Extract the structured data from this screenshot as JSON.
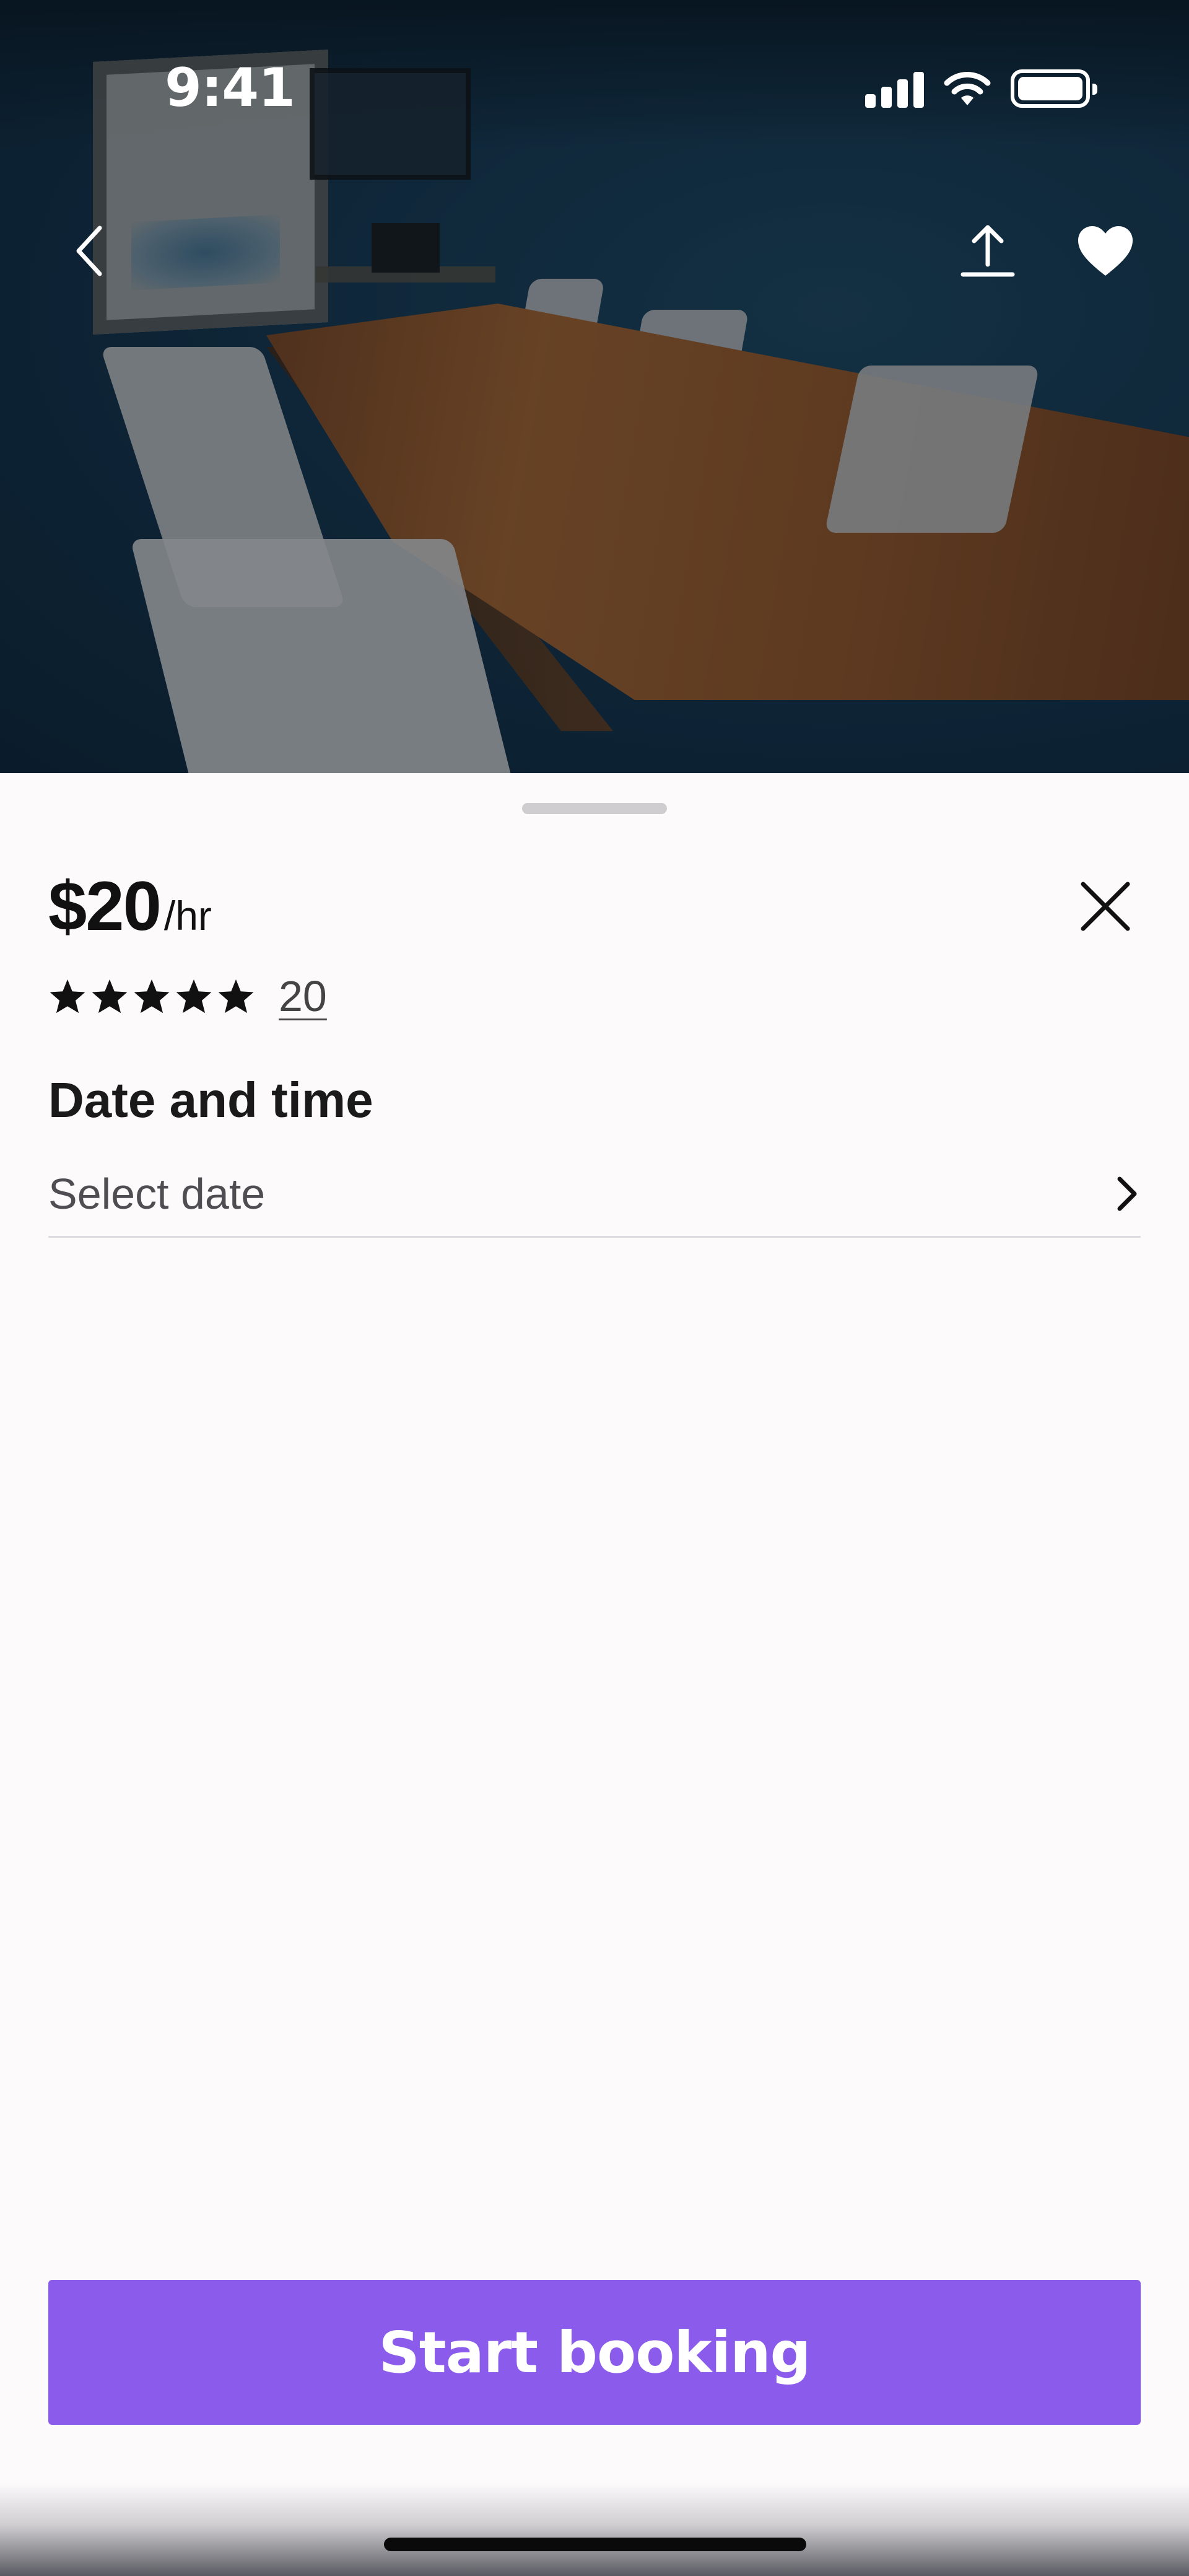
{
  "status_bar": {
    "time": "9:41"
  },
  "hero": {
    "back_icon": "chevron-left-icon",
    "share_icon": "share-upload-icon",
    "favorite_icon": "heart-filled-icon"
  },
  "listing": {
    "price": "$20",
    "price_unit": "/hr",
    "rating_stars": 5,
    "review_count": "20"
  },
  "booking": {
    "section_title": "Date and time",
    "date_placeholder": "Select date",
    "cta_label": "Start booking"
  },
  "colors": {
    "accent": "#8b5bec",
    "text_primary": "#111111",
    "text_secondary": "#4f4d52",
    "background": "#fcfafb"
  }
}
